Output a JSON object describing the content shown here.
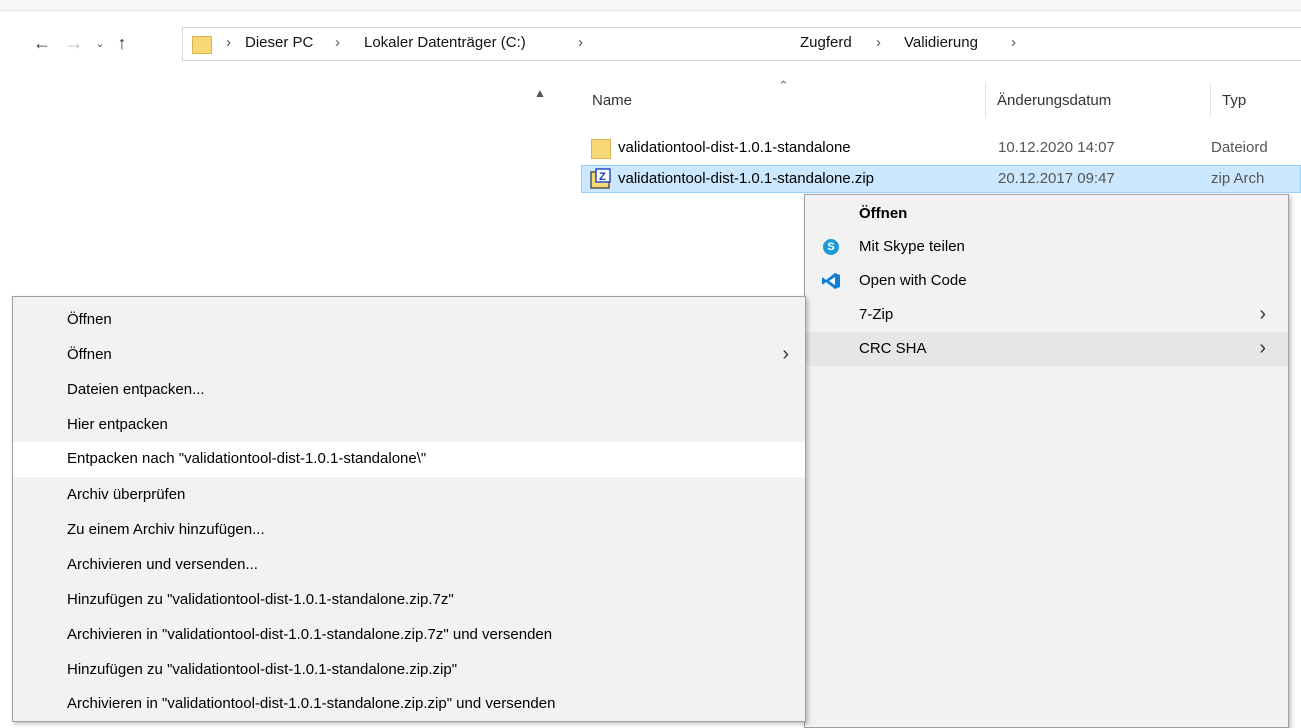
{
  "explorer": {
    "breadcrumb": [
      "Dieser PC",
      "Lokaler Datenträger (C:)",
      "Zugferd",
      "Validierung"
    ],
    "columns": {
      "name": "Name",
      "date": "Änderungsdatum",
      "type": "Typ"
    },
    "files": [
      {
        "name": "validationtool-dist-1.0.1-standalone",
        "date": "10.12.2020 14:07",
        "type": "Dateiord",
        "icon": "folder-icon"
      },
      {
        "name": "validationtool-dist-1.0.1-standalone.zip",
        "date": "20.12.2017 09:47",
        "type": "zip Arch",
        "icon": "zip-archive-icon",
        "selected": true
      }
    ]
  },
  "shell_menu": {
    "items": [
      {
        "label": "Öffnen",
        "bold": true
      },
      {
        "label": "Mit Skype teilen",
        "icon": "skype-icon"
      },
      {
        "label": "Open with Code",
        "icon": "vscode-icon"
      },
      {
        "label": "7-Zip",
        "submenu": true
      },
      {
        "label": "CRC SHA",
        "submenu": true,
        "highlighted": true
      }
    ]
  },
  "zip_menu": {
    "items": [
      {
        "label": "Öffnen"
      },
      {
        "label": "Öffnen",
        "submenu": true
      },
      {
        "label": "Dateien entpacken..."
      },
      {
        "label": "Hier entpacken"
      },
      {
        "label": "Entpacken nach \"validationtool-dist-1.0.1-standalone\\\"",
        "highlighted": true
      },
      {
        "label": "Archiv überprüfen"
      },
      {
        "label": "Zu einem Archiv hinzufügen..."
      },
      {
        "label": "Archivieren und versenden..."
      },
      {
        "label": "Hinzufügen zu \"validationtool-dist-1.0.1-standalone.zip.7z\""
      },
      {
        "label": "Archivieren in \"validationtool-dist-1.0.1-standalone.zip.7z\" und versenden"
      },
      {
        "label": "Hinzufügen zu \"validationtool-dist-1.0.1-standalone.zip.zip\""
      },
      {
        "label": "Archivieren in \"validationtool-dist-1.0.1-standalone.zip.zip\" und versenden"
      }
    ]
  },
  "colors": {
    "selection": "#cce8ff",
    "menu_bg": "#f2f2f2",
    "menu_highlight": "#ffffff",
    "folder": "#f8d775"
  }
}
